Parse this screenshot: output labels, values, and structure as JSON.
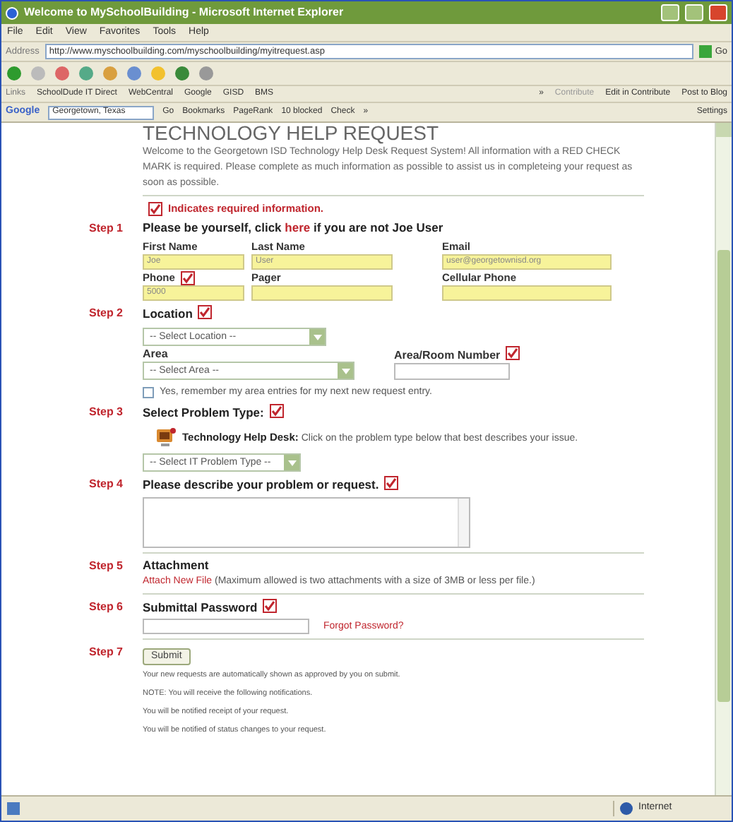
{
  "window": {
    "title": "Welcome to MySchoolBuilding - Microsoft Internet Explorer"
  },
  "menu": [
    "File",
    "Edit",
    "View",
    "Favorites",
    "Tools",
    "Help"
  ],
  "address": {
    "label": "Address",
    "value": "http://www.myschoolbuilding.com/myschoolbuilding/myitrequest.asp",
    "go": "Go"
  },
  "links_bar": {
    "label": "Links",
    "items": [
      "SchoolDude IT Direct",
      "WebCentral",
      "Google",
      "GISD",
      "BMS"
    ],
    "chevron": "»",
    "right_items": [
      "Contribute",
      "Edit in Contribute",
      "Post to Blog"
    ]
  },
  "google_bar": {
    "label": "Google",
    "search_value": "Georgetown, Texas",
    "items": [
      "Go",
      "Bookmarks",
      "PageRank",
      "10 blocked",
      "Check",
      "»"
    ],
    "settings": "Settings"
  },
  "page": {
    "heading": "TECHNOLOGY HELP REQUEST",
    "intro": "Welcome to the Georgetown ISD Technology Help Desk Request System! All information with a RED CHECK MARK is required. Please complete as much information as possible to assist us in completeing your request as soon as possible.",
    "required_note": "Indicates required information.",
    "steps": [
      {
        "kind": "identity",
        "label": "Step 1",
        "title_before": "Please be yourself, click",
        "link": "here",
        "title_after": "if you are not Joe User",
        "fields": [
          {
            "label": "First Name",
            "value": "Joe"
          },
          {
            "label": "Last Name",
            "value": "User"
          },
          {
            "label": "Email",
            "value": "user@georgetownisd.org"
          },
          {
            "label": "Phone",
            "required": true,
            "value": "5000"
          },
          {
            "label": "Pager"
          },
          {
            "label": "Cellular Phone"
          }
        ]
      },
      {
        "kind": "location",
        "label": "Step 2",
        "title": "Location",
        "required": true,
        "location_select": "-- Select Location --",
        "area_label": "Area",
        "area_select": "-- Select Area --",
        "room_label": "Area/Room Number",
        "room_required": true,
        "remember": {
          "label": "Yes, remember my area entries for my next new request entry.",
          "checked": false
        }
      },
      {
        "kind": "problem",
        "label": "Step 3",
        "title": "Select Problem Type:",
        "required": true,
        "desk": "Technology Help Desk:",
        "desk_text": "Click on the problem type below that best describes your issue.",
        "select": "-- Select IT Problem Type --"
      },
      {
        "kind": "describe",
        "label": "Step 4",
        "title": "Please describe your problem or request.",
        "required": true
      },
      {
        "kind": "attachment",
        "label": "Step 5",
        "title": "Attachment",
        "link": "Attach New File",
        "note": "(Maximum allowed is two attachments with a size of 3MB or less per file.)"
      },
      {
        "kind": "password",
        "label": "Step 6",
        "title": "Submittal Password",
        "required": true,
        "link": "Forgot Password?"
      },
      {
        "kind": "submit",
        "label": "Step 7",
        "button": "Submit",
        "notes": [
          "Your new requests are automatically shown as approved by you on submit.",
          "NOTE: You will receive the following notifications.",
          "You will be notified receipt of your request.",
          "You will be notified of status changes to your request."
        ]
      }
    ]
  },
  "status_bar": {
    "zone": "Internet"
  }
}
